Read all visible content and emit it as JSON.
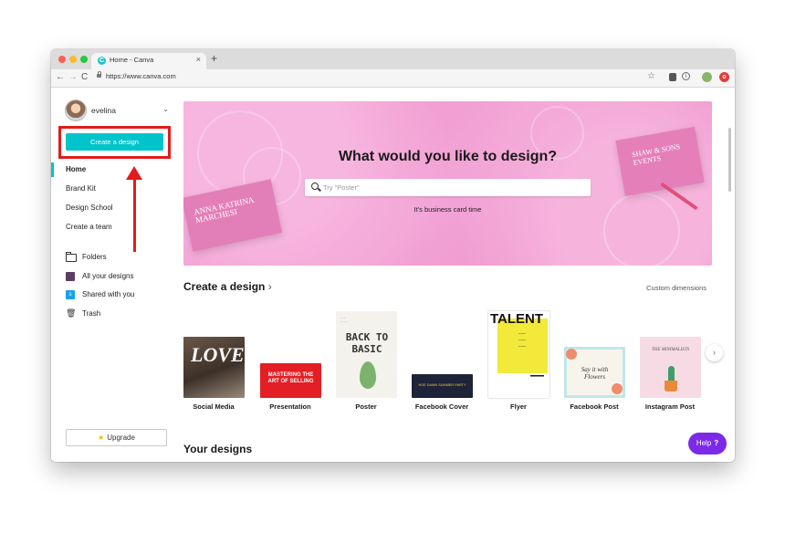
{
  "browser": {
    "tab_title": "Home - Canva",
    "tab_close": "×",
    "new_tab": "+",
    "url": "https://www.canva.com",
    "icons": [
      "back-arrow-icon",
      "forward-arrow-icon",
      "reload-icon",
      "lock-icon",
      "star-icon"
    ]
  },
  "sidebar": {
    "profile_name": "evelina",
    "create_button": "Create a design",
    "links": [
      {
        "label": "Home",
        "active": true
      },
      {
        "label": "Brand Kit"
      },
      {
        "label": "Design School"
      },
      {
        "label": "Create a team"
      }
    ],
    "folders": [
      {
        "label": "Folders",
        "icon": "folder-icon"
      },
      {
        "label": "All your designs",
        "icon": "grid-icon"
      },
      {
        "label": "Shared with you",
        "icon": "shared-icon"
      },
      {
        "label": "Trash",
        "icon": "trash-icon"
      }
    ],
    "upgrade": "Upgrade",
    "annotation_color": "#e21b1b"
  },
  "hero": {
    "title": "What would you like to design?",
    "search_placeholder": "Try \"Poster\"",
    "subtitle": "It's business card time",
    "card_left": "ANNA KATRINA MARCHESI",
    "card_right": "SHAW & SONS EVENTS"
  },
  "create": {
    "title": "Create a design",
    "custom": "Custom dimensions",
    "items": [
      {
        "label": "Social Media",
        "thumb_text": "LOVE"
      },
      {
        "label": "Presentation",
        "thumb_text": "MASTERING THE ART OF SELLING"
      },
      {
        "label": "Poster",
        "thumb_text": "BACK TO BASIC"
      },
      {
        "label": "Facebook Cover",
        "thumb_text": "HOE DAWN SUMMER PARTY"
      },
      {
        "label": "Flyer",
        "thumb_text": "TALENT"
      },
      {
        "label": "Facebook Post",
        "thumb_text": "Say it with Flowers"
      },
      {
        "label": "Instagram Post",
        "thumb_text": "THE MINIMALISTS"
      }
    ]
  },
  "your_designs": "Your designs",
  "help": {
    "label": "Help",
    "icon": "?"
  },
  "colors": {
    "brand_teal": "#00c4cc",
    "help_purple": "#7d2ae8"
  }
}
